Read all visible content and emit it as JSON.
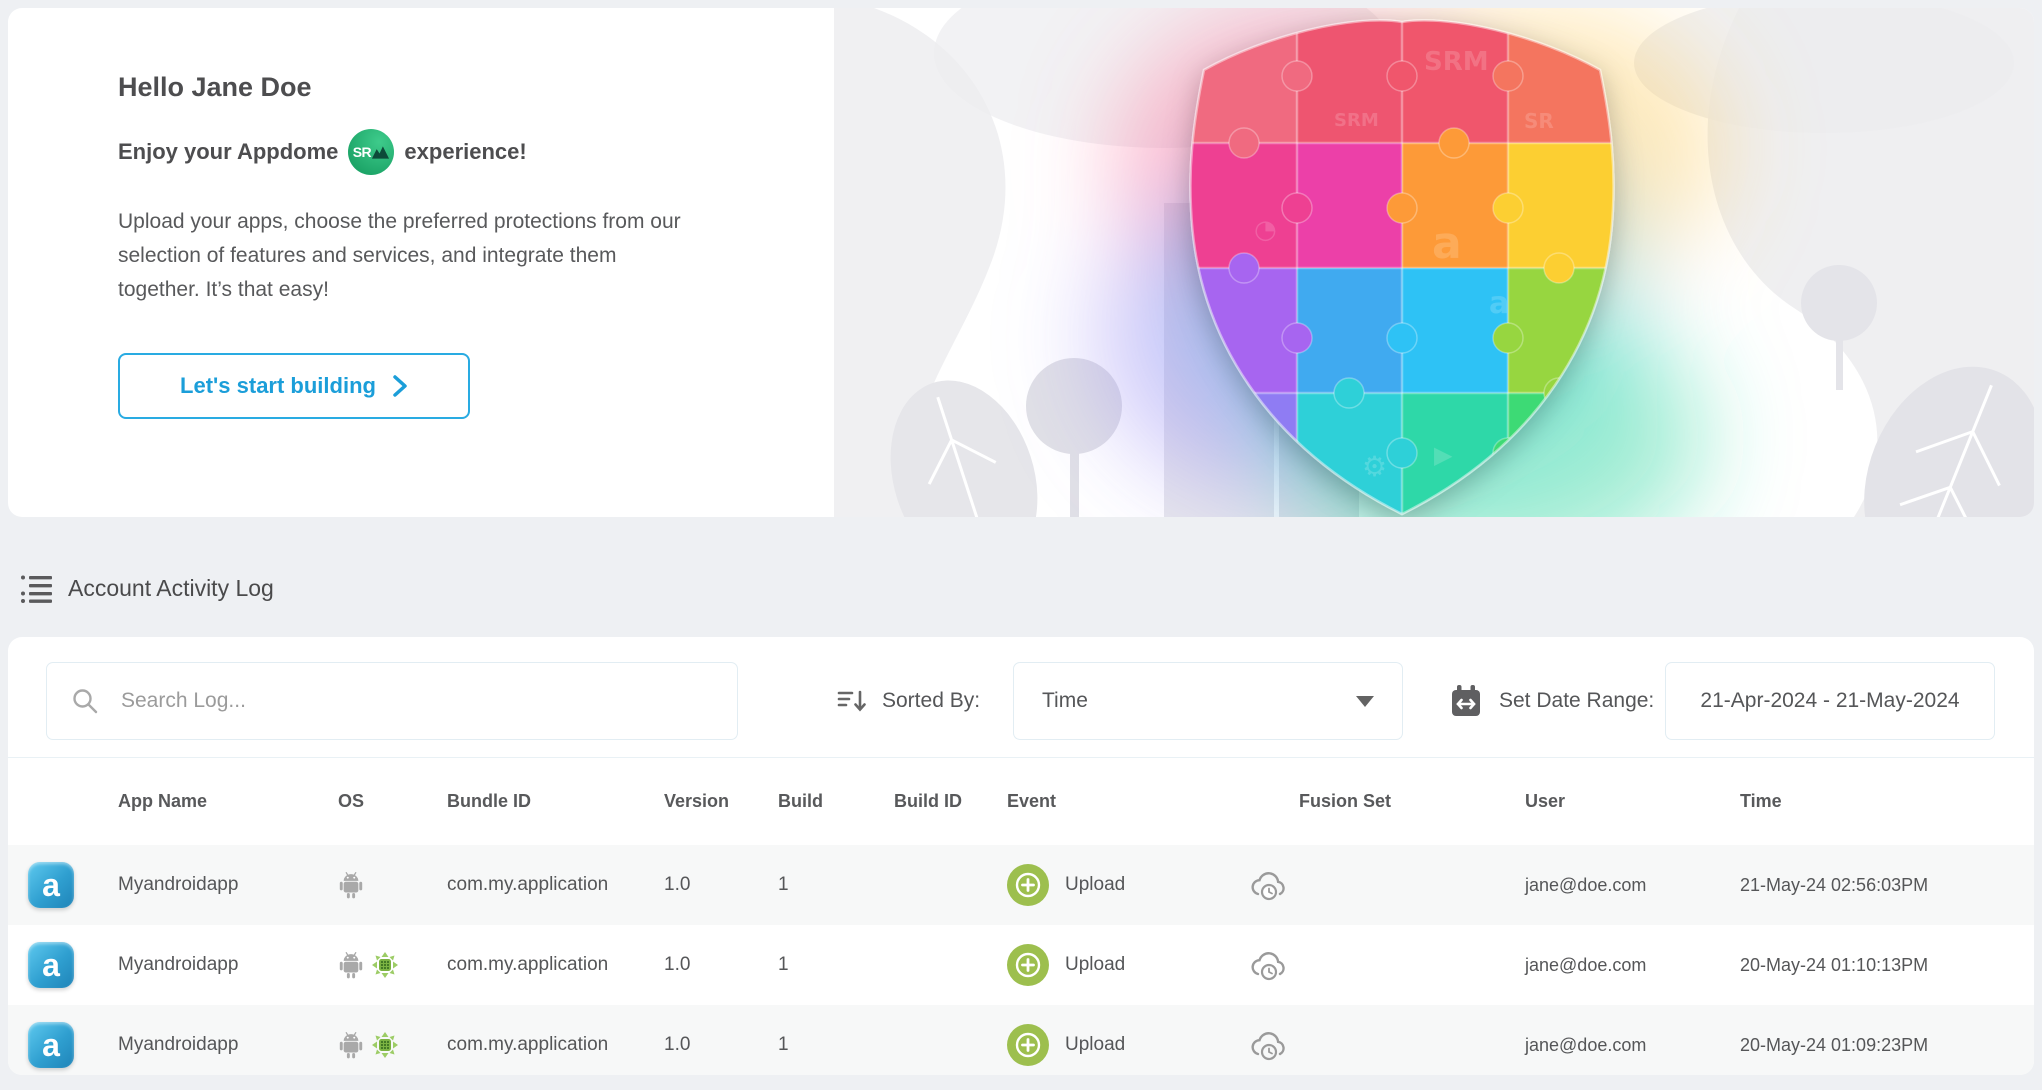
{
  "hero": {
    "greeting": "Hello Jane Doe",
    "subtitle_prefix": "Enjoy your Appdome",
    "subtitle_suffix": "experience!",
    "logo_badge": "SR",
    "description": "Upload your apps, choose the preferred protections from our selection of features and services, and integrate them together. It’s that easy!",
    "cta_label": "Let's start building"
  },
  "section_header": {
    "title": "Account Activity Log"
  },
  "controls": {
    "search_placeholder": "Search Log...",
    "sorted_by_label": "Sorted By:",
    "sort_value": "Time",
    "date_label": "Set Date Range:",
    "date_value": "21-Apr-2024 - 21-May-2024"
  },
  "table": {
    "columns": [
      "App Name",
      "OS",
      "Bundle ID",
      "Version",
      "Build",
      "Build ID",
      "Event",
      "Fusion Set",
      "User",
      "Time"
    ],
    "rows": [
      {
        "app_name": "Myandroidapp",
        "os": "android",
        "bundle_id": "com.my.application",
        "version": "1.0",
        "build": "1",
        "build_id": "",
        "event": "Upload",
        "fusion_set_icon": "cloud-history-icon",
        "user": "jane@doe.com",
        "time": "21-May-24 02:56:03PM"
      },
      {
        "app_name": "Myandroidapp",
        "os": "android, fused-android",
        "bundle_id": "com.my.application",
        "version": "1.0",
        "build": "1",
        "build_id": "",
        "event": "Upload",
        "fusion_set_icon": "cloud-history-icon",
        "user": "jane@doe.com",
        "time": "20-May-24 01:10:13PM"
      },
      {
        "app_name": "Myandroidapp",
        "os": "android, fused-android",
        "bundle_id": "com.my.application",
        "version": "1.0",
        "build": "1",
        "build_id": "",
        "event": "Upload",
        "fusion_set_icon": "cloud-history-icon",
        "user": "jane@doe.com",
        "time": "20-May-24 01:09:23PM"
      }
    ]
  },
  "icons": {
    "app_letter": "a",
    "section": "list-icon",
    "search": "magnifier-icon",
    "sort": "sort-descending-icon",
    "dropdown_caret": "chevron-down-icon",
    "calendar": "calendar-range-icon",
    "event_upload": "plus-circle-icon",
    "fusion": "cloud-history-icon",
    "cta": "chevron-right-icon"
  },
  "colors": {
    "accent_blue": "#1b9ed9",
    "accent_blue_border": "#29abe2",
    "upload_green": "#9dbf4e",
    "logo_green": "#23ab6e",
    "android_gray": "#a9a9a9",
    "fused_green": "#7cb342",
    "page_bg": "#eef0f3",
    "stripe_bg": "#f7f8f8",
    "text_dark": "#4d4d4f",
    "text_body": "#58595b"
  }
}
